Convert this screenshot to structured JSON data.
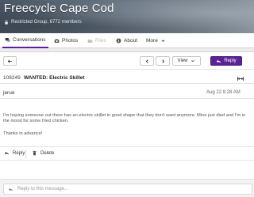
{
  "group": {
    "name": "Freecycle Cape Cod",
    "meta": "Restricted Group, 6772 members"
  },
  "tabs": [
    {
      "label": "Conversations",
      "icon": "chat-icon",
      "active": true
    },
    {
      "label": "Photos",
      "icon": "camera-icon"
    },
    {
      "label": "Files",
      "icon": "folder-icon",
      "disabled": true
    },
    {
      "label": "About",
      "icon": "info-icon"
    },
    {
      "label": "More",
      "icon": "chevron-down-icon"
    }
  ],
  "toolbar": {
    "back_icon": "arrow-left-icon",
    "prev_icon": "chevron-left-icon",
    "next_icon": "chevron-right-icon",
    "view_label": "View",
    "reply_label": "Reply"
  },
  "message": {
    "number": "108249",
    "subject": "WANTED: Electric Skillet",
    "author": "jerue",
    "date": "Aug 22 9:28 AM",
    "body": "I'm hoping someone out there has an electric skillet in good shape that they don't want anymore. Mine just died and I'm in the mood for some fried chicken.",
    "signoff": "Thanks in advance!"
  },
  "actions": {
    "reply_label": "Reply",
    "delete_label": "Delete"
  },
  "composer": {
    "placeholder": "Reply to this message..."
  },
  "colors": {
    "accent": "#5b2196",
    "banner": "#5d6b78"
  }
}
